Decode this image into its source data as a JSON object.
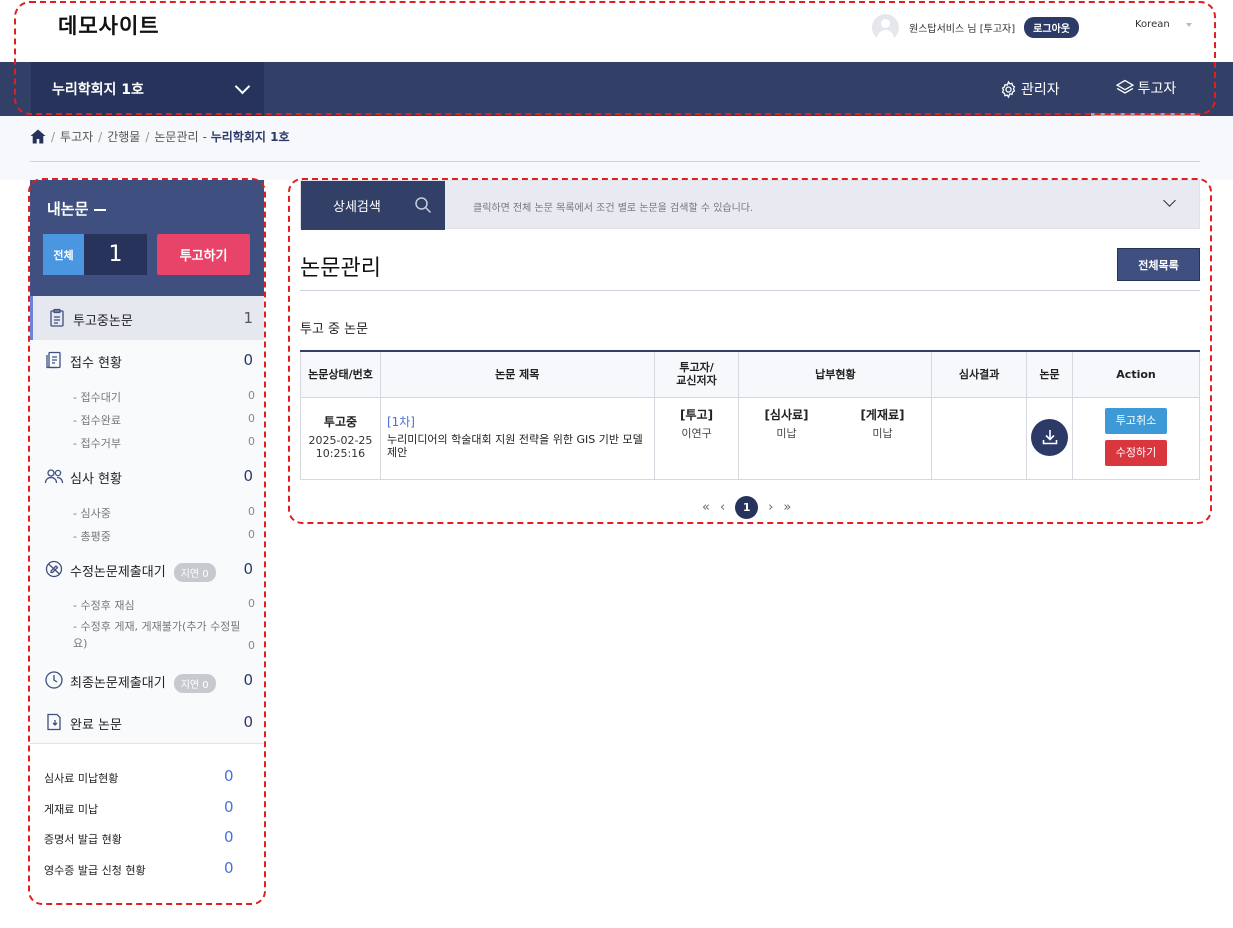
{
  "header": {
    "site_title": "데모사이트",
    "user_name": "원스탑서비스 님 [투고자]",
    "logout_label": "로그아웃",
    "language": "Korean"
  },
  "nav": {
    "journal": "누리학회지 1호",
    "admin_label": "관리자",
    "author_label": "투고자"
  },
  "breadcrumb": {
    "items": [
      "투고자",
      "간행물",
      "논문관리"
    ],
    "current": "누리학회지 1호",
    "current_prefix": "- "
  },
  "sidebar": {
    "title": "내논문",
    "total_label": "전체",
    "total_count": "1",
    "submit_label": "투고하기",
    "menu": [
      {
        "label": "투고중논문",
        "count": "1"
      },
      {
        "label": "접수 현황",
        "count": "0"
      },
      {
        "label": "심사 현황",
        "count": "0"
      },
      {
        "label": "수정논문제출대기",
        "count": "0",
        "badge": "지연 0"
      },
      {
        "label": "최종논문제출대기",
        "count": "0",
        "badge": "지연 0"
      },
      {
        "label": "완료 논문",
        "count": "0"
      }
    ],
    "sub_receipt": [
      {
        "label": "- 접수대기",
        "count": "0"
      },
      {
        "label": "- 접수완료",
        "count": "0"
      },
      {
        "label": "- 접수거부",
        "count": "0"
      }
    ],
    "sub_review": [
      {
        "label": "- 심사중",
        "count": "0"
      },
      {
        "label": "- 총평중",
        "count": "0"
      }
    ],
    "sub_revision": [
      {
        "label": "- 수정후 재심",
        "count": "0"
      },
      {
        "label": "- 수정후 게재, 게재불가(추가 수정필요)",
        "count": "0"
      }
    ],
    "stats": [
      {
        "label": "심사료 미납현황",
        "count": "0"
      },
      {
        "label": "게재료 미납",
        "count": "0"
      },
      {
        "label": "증명서 발급 현황",
        "count": "0"
      },
      {
        "label": "영수증 발급 신청 현황",
        "count": "0"
      }
    ]
  },
  "search": {
    "tab_label": "상세검색",
    "hint": "클릭하면 전체 논문 목록에서 조건 별로 논문을 검색할 수 있습니다."
  },
  "main": {
    "page_title": "논문관리",
    "list_all_label": "전체목록",
    "section_label": "투고 중 논문",
    "table": {
      "headers": {
        "status": "논문상태/번호",
        "title": "논문 제목",
        "author_line1": "투고자/",
        "author_line2": "교신저자",
        "payment": "납부현황",
        "result": "심사결과",
        "paper": "논문",
        "action": "Action"
      },
      "rows": [
        {
          "status": "투고중",
          "date": "2025-02-25",
          "time": "10:25:16",
          "round": "[1차]",
          "title": "누리미디어의 학술대회 지원 전략을 위한 GIS 기반 모델 제안",
          "author_tag": "[투고]",
          "author_name": "이연구",
          "review_fee_tag": "[심사료]",
          "review_fee_val": "미납",
          "pub_fee_tag": "[게재료]",
          "pub_fee_val": "미납",
          "result": "",
          "cancel_label": "투고취소",
          "edit_label": "수정하기"
        }
      ]
    },
    "pagination": {
      "first": "«",
      "prev": "‹",
      "current": "1",
      "next": "›",
      "last": "»"
    }
  }
}
